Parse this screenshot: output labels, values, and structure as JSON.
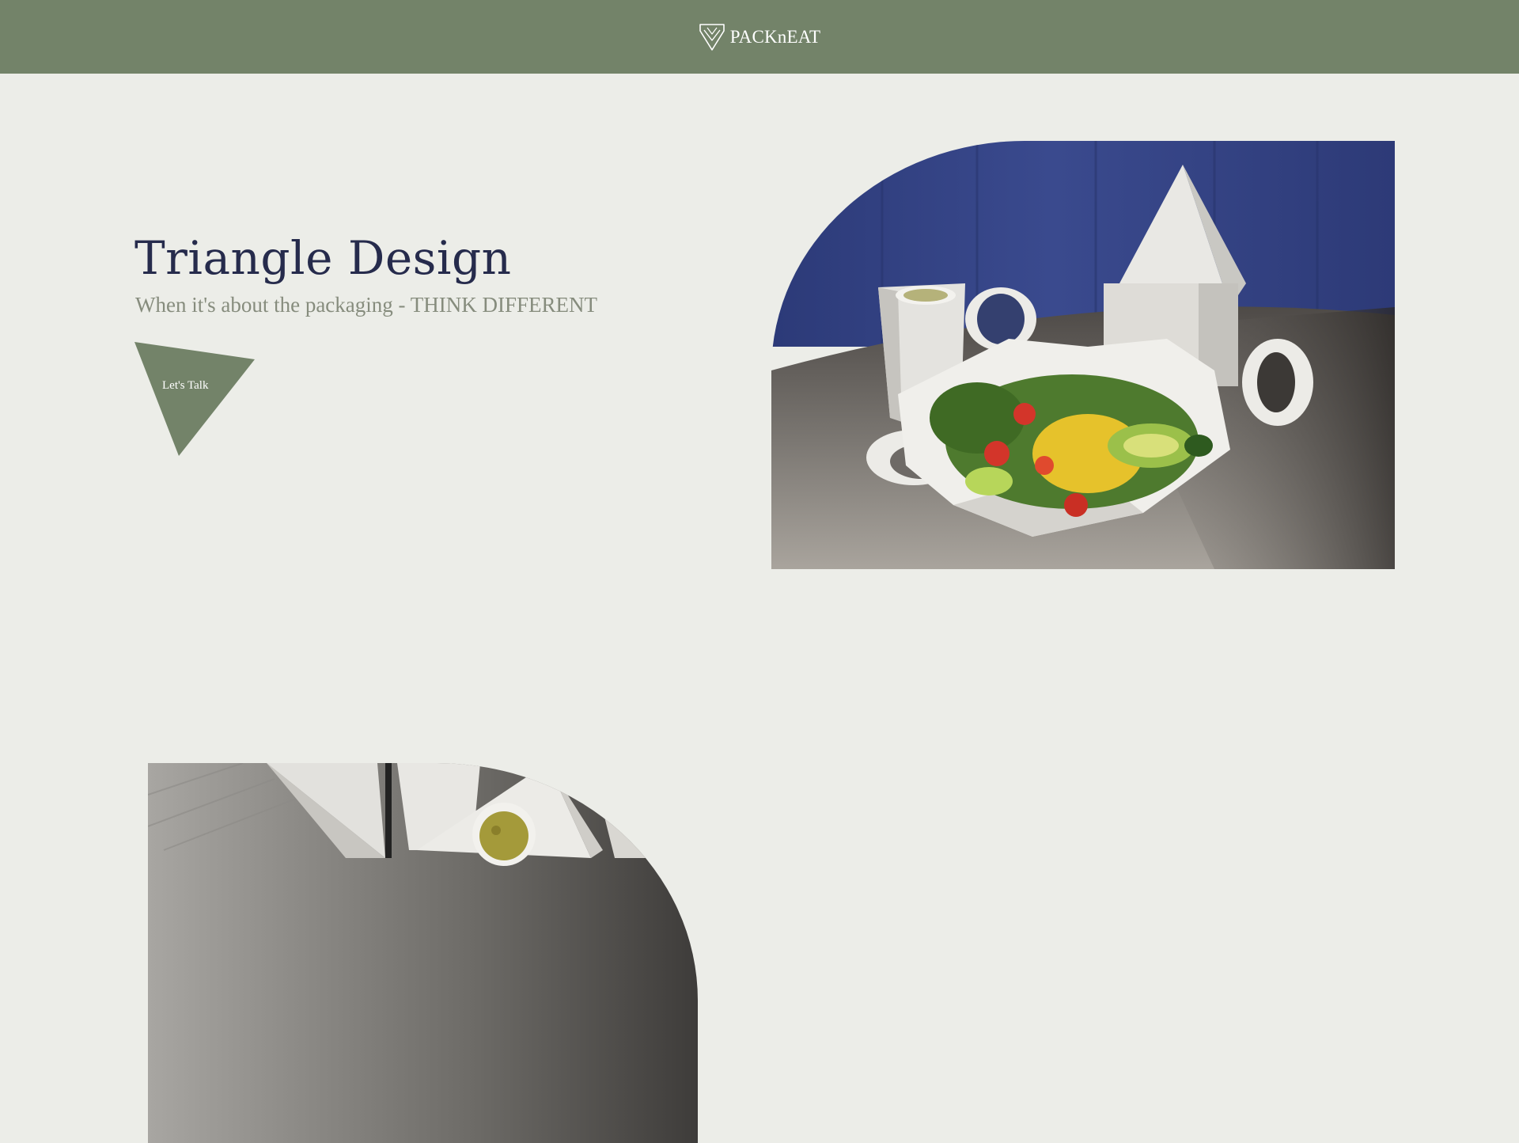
{
  "header": {
    "brand_name": "PACKnEAT",
    "logo_icon": "chevron-shield-logo",
    "background_color": "#738369"
  },
  "hero": {
    "title": "Triangle Design",
    "subtitle": "When it's about the packaging - THINK DIFFERENT",
    "cta_label": "Let's Talk",
    "cta_color": "#738369",
    "title_color": "#262b4c"
  },
  "images": [
    {
      "name": "salad-in-triangle-packaging"
    },
    {
      "name": "triangle-boxes-with-soup-cup"
    }
  ]
}
